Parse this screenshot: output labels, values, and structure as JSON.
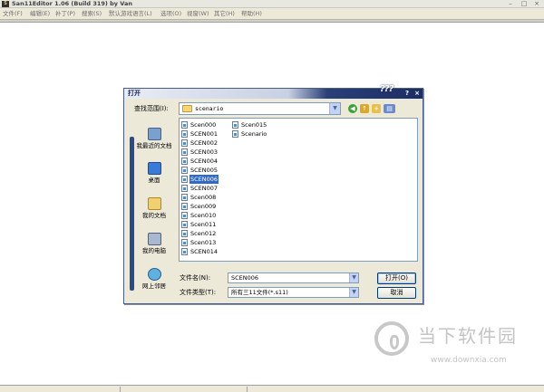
{
  "app": {
    "icon_text": "S",
    "title": "San11Editor 1.06 (Build 319) by Van",
    "menu": [
      "文件(F)",
      "编辑(E)",
      "补丁(P)",
      "搜索(S)",
      "默认游戏语言(L)",
      "选项(O)",
      "视窗(W)",
      "其它(H)",
      "帮助(H)"
    ]
  },
  "dialog": {
    "title": "打开",
    "logo": "???",
    "help_glyph": "?",
    "close_glyph": "×",
    "look_in_label": "查找范围(I):",
    "look_in_value": "scenario",
    "places": [
      {
        "label": "我最近的文档",
        "icon": "recent-documents-icon"
      },
      {
        "label": "桌面",
        "icon": "desktop-icon"
      },
      {
        "label": "我的文档",
        "icon": "my-documents-icon"
      },
      {
        "label": "我的电脑",
        "icon": "my-computer-icon"
      },
      {
        "label": "网上邻居",
        "icon": "network-places-icon"
      }
    ],
    "files": [
      "Scen000",
      "SCEN001",
      "SCEN002",
      "SCEN003",
      "SCEN004",
      "SCEN005",
      "SCEN006",
      "SCEN007",
      "Scen008",
      "Scen009",
      "Scen010",
      "Scen011",
      "Scen012",
      "Scen013",
      "SCEN014",
      "Scen015",
      "Scenario"
    ],
    "selected_file": "SCEN006",
    "filename_label": "文件名(N):",
    "filename_value": "SCEN006",
    "filetype_label": "文件类型(T):",
    "filetype_value": "所有三11文件(*.s11)",
    "open_button": "打开(O)",
    "cancel_button": "取消"
  },
  "watermark": {
    "title": "当下软件园",
    "url": "www.downxia.com"
  },
  "colors": {
    "selection": "#316ac5",
    "dialog_bg": "#ece9d8",
    "title_dark": "#1c2e64"
  }
}
